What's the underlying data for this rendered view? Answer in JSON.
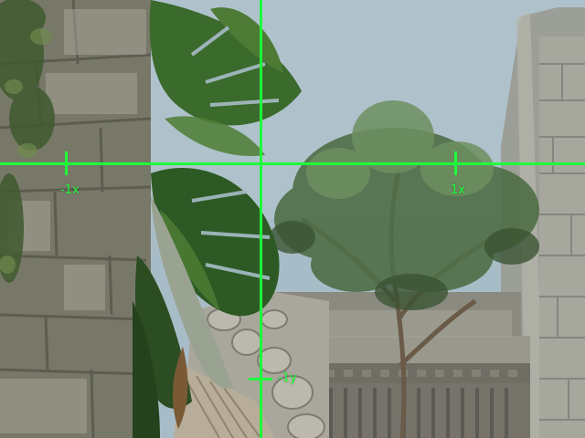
{
  "crosshair": {
    "color": "#1dff3a",
    "labels": {
      "left_x": "-1x",
      "right_x": "1x",
      "bottom_y": "-1y"
    }
  },
  "scene": {
    "sky_color": "#a9bcc6",
    "stone_color": "#8f8f86",
    "foliage_color": "#2f5a2b"
  }
}
